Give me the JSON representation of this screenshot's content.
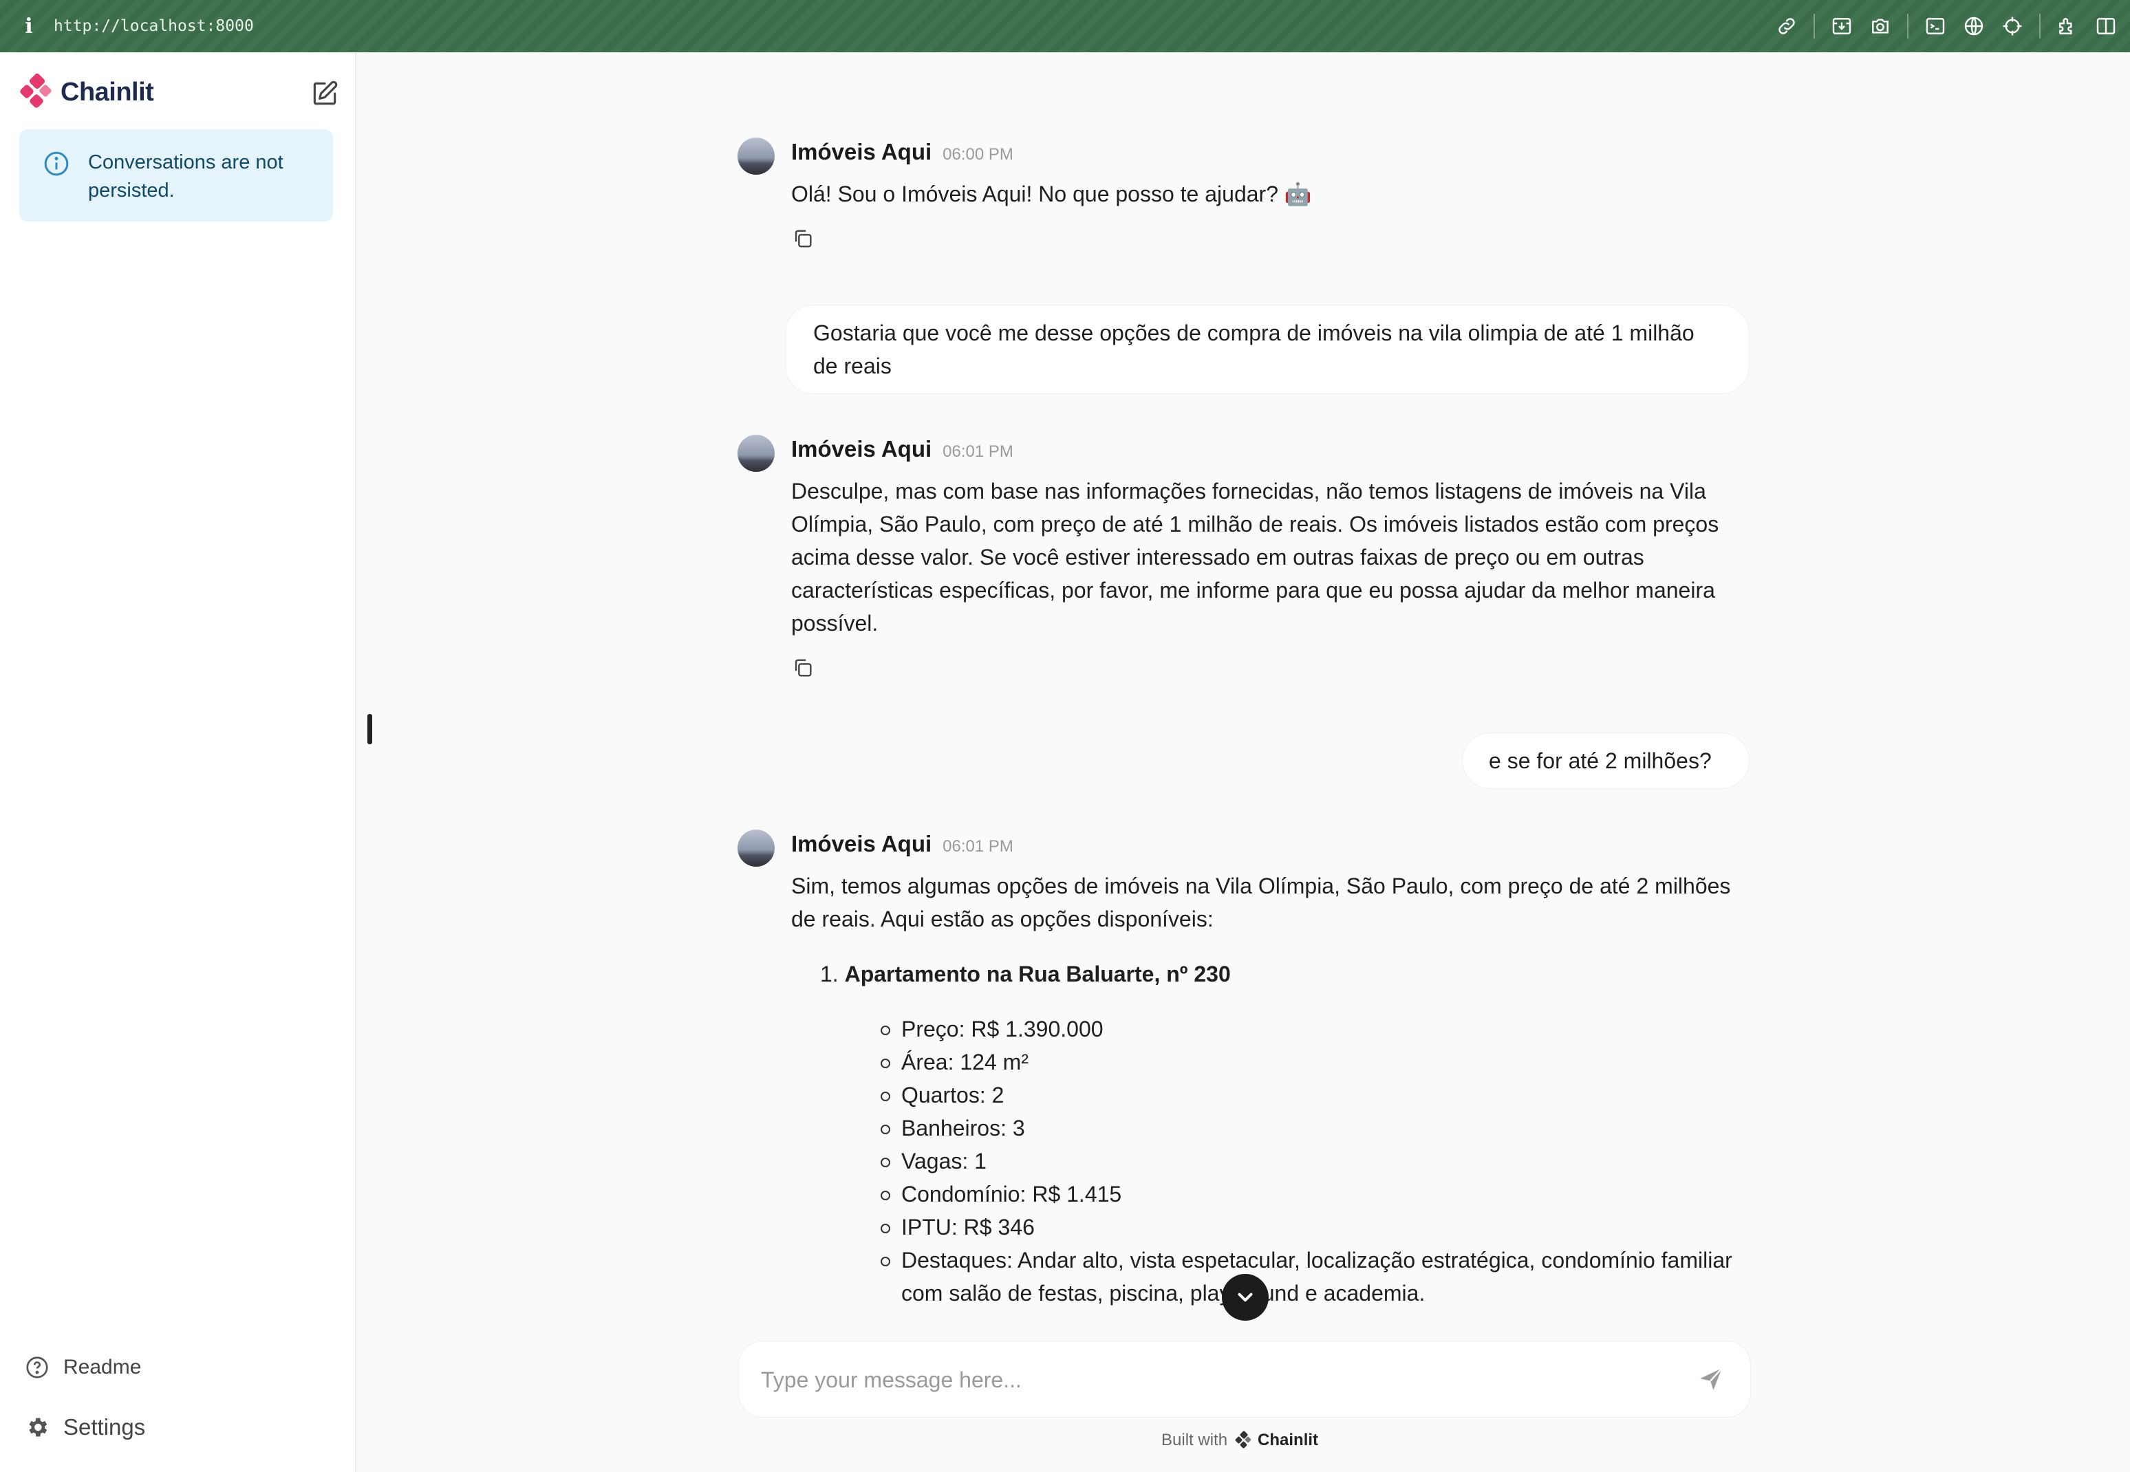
{
  "browser": {
    "info_glyph": "i",
    "url": "http://localhost:8000",
    "tools": [
      "link-icon",
      "download-icon",
      "camera-icon",
      "terminal-icon",
      "globe-icon",
      "crosshair-icon",
      "extension-icon",
      "sidebar-toggle-icon"
    ]
  },
  "sidebar": {
    "app_name": "Chainlit",
    "notice": "Conversations are not persisted.",
    "readme_label": "Readme",
    "settings_label": "Settings"
  },
  "messages": [
    {
      "author": "Imóveis Aqui",
      "time": "06:00 PM",
      "text": "Olá! Sou o Imóveis Aqui! No que posso te ajudar? 🤖"
    },
    {
      "user": "Gostaria que você me desse opções de compra de imóveis na vila olimpia de até 1 milhão de reais"
    },
    {
      "author": "Imóveis Aqui",
      "time": "06:01 PM",
      "text": "Desculpe, mas com base nas informações fornecidas, não temos listagens de imóveis na Vila Olímpia, São Paulo, com preço de até 1 milhão de reais. Os imóveis listados estão com preços acima desse valor. Se você estiver interessado em outras faixas de preço ou em outras características específicas, por favor, me informe para que eu possa ajudar da melhor maneira possível."
    },
    {
      "user": "e se for até 2 milhões?"
    },
    {
      "author": "Imóveis Aqui",
      "time": "06:01 PM",
      "intro": "Sim, temos algumas opções de imóveis na Vila Olímpia, São Paulo, com preço de até 2 milhões de reais. Aqui estão as opções disponíveis:",
      "list_number": "1.",
      "list_title": "Apartamento na Rua Baluarte, nº 230",
      "details": [
        "Preço: R$ 1.390.000",
        "Área: 124 m²",
        "Quartos: 2",
        "Banheiros: 3",
        "Vagas: 1",
        "Condomínio: R$ 1.415",
        "IPTU: R$ 346",
        "Destaques: Andar alto, vista espetacular, localização estratégica, condomínio familiar com salão de festas, piscina, playground e academia."
      ]
    }
  ],
  "composer": {
    "placeholder": "Type your message here...",
    "footer_prefix": "Built with",
    "footer_brand": "Chainlit"
  }
}
